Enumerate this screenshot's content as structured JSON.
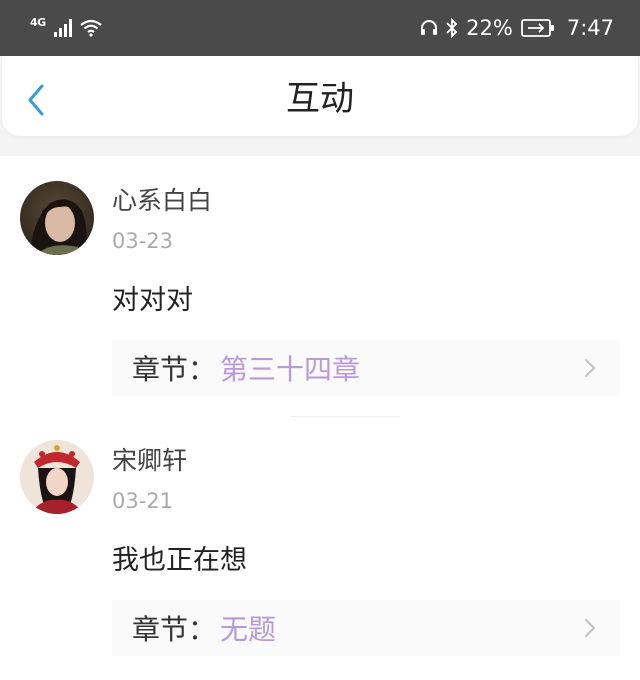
{
  "status_bar": {
    "network_type": "4G",
    "battery_percent": "22%",
    "time": "7:47",
    "icons": [
      "signal-icon",
      "wifi-icon",
      "headset-icon",
      "bluetooth-icon",
      "battery-charging-icon"
    ]
  },
  "header": {
    "title": "互动",
    "back_icon": "chevron-left-icon",
    "accent_color": "#3a9ad9"
  },
  "comments": [
    {
      "username": "心系白白",
      "date": "03-23",
      "text": "对对对",
      "chapter_label": "章节：",
      "chapter_value": "第三十四章"
    },
    {
      "username": "宋卿轩",
      "date": "03-21",
      "text": "我也正在想",
      "chapter_label": "章节：",
      "chapter_value": "无题"
    }
  ],
  "colors": {
    "chapter_value": "#b79ad6",
    "status_bar_bg": "#4a4a4a",
    "date_text": "#aaaaaa"
  }
}
